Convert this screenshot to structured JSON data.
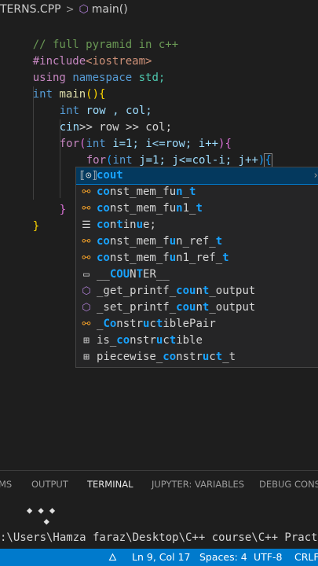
{
  "breadcrumb": {
    "file": "TERNS.CPP",
    "separator": ">",
    "symbol": "main()",
    "symbol_icon": "cube-icon"
  },
  "code": {
    "comment": "// full pyramid in c++",
    "include_directive": "#include",
    "include_header": "<iostream>",
    "using": "using",
    "namespace": "namespace",
    "std": "std;",
    "int": "int",
    "main": "main",
    "paren_open": "(",
    "paren_close": ")",
    "brace_open": "{",
    "brace_close": "}",
    "row_col_decl": "row , col;",
    "cin": "cin",
    "cin_rest": ">> row >> col;",
    "for": "for",
    "i_init": "i=1; i<=row; i++",
    "j_init_a": "j=1; j<=col-i; j++",
    "cout_typed": "cout"
  },
  "suggestions": [
    {
      "icon": "variable-icon",
      "prefix": "",
      "match": "cout",
      "suffix": "",
      "selected": true
    },
    {
      "icon": "class-icon",
      "label": "const_mem_fun_t"
    },
    {
      "icon": "class-icon",
      "label": "const_mem_fun1_t"
    },
    {
      "icon": "keyword-icon",
      "label": "continue;"
    },
    {
      "icon": "class-icon",
      "label": "const_mem_fun_ref_t"
    },
    {
      "icon": "class-icon",
      "label": "const_mem_fun1_ref_t"
    },
    {
      "icon": "text-icon",
      "label": "__COUNTER__"
    },
    {
      "icon": "method-icon",
      "label": "_get_printf_count_output"
    },
    {
      "icon": "method-icon",
      "label": "_set_printf_count_output"
    },
    {
      "icon": "class-icon",
      "label": "_ConstructiblePair"
    },
    {
      "icon": "struct-icon",
      "label": "is_constructible"
    },
    {
      "icon": "struct-icon",
      "label": "piecewise_construct_t"
    }
  ],
  "panel": {
    "tabs": [
      "MS",
      "OUTPUT",
      "TERMINAL",
      "JUPYTER: VARIABLES",
      "DEBUG CONSO"
    ],
    "active_tab": "TERMINAL"
  },
  "terminal": {
    "prompt": ":\\Users\\Hamza faraz\\Desktop\\C++ course\\C++ Practice>"
  },
  "statusbar": {
    "line_col": "Ln 9, Col 17",
    "spaces": "Spaces: 4",
    "encoding": "UTF-8",
    "eol": "CRLF"
  },
  "colors": {
    "accent": "#007acc",
    "background": "#1e1e1e",
    "suggest_bg": "#252526",
    "match": "#18a3ff"
  }
}
